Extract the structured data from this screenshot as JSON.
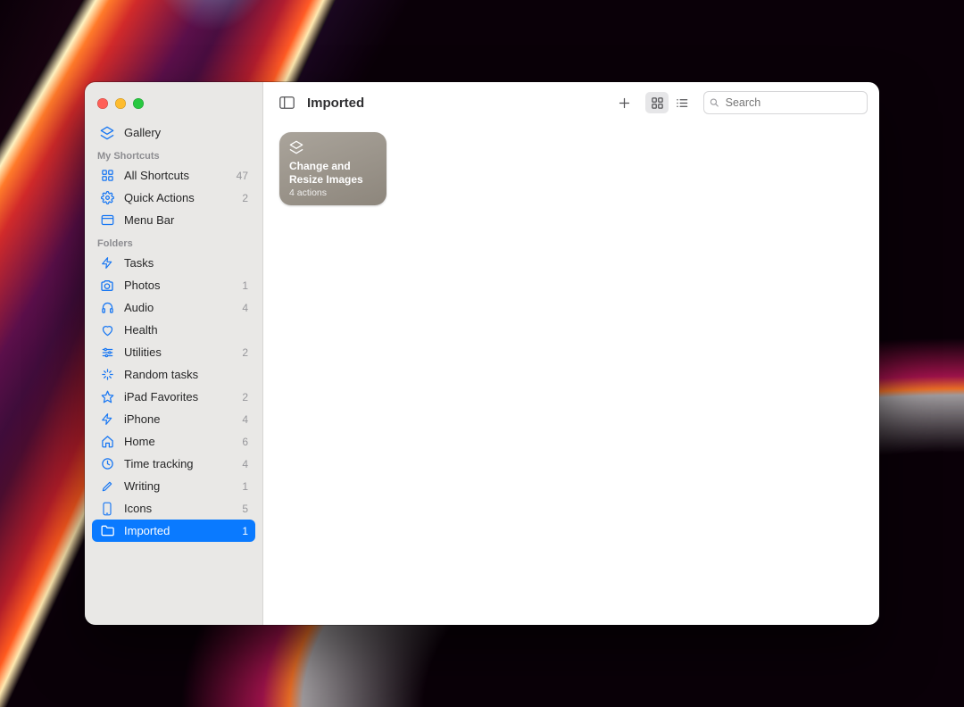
{
  "window": {
    "title": "Imported"
  },
  "toolbar": {
    "search_placeholder": "Search",
    "view_mode": "grid"
  },
  "sidebar": {
    "gallery_label": "Gallery",
    "sections": [
      {
        "header": "My Shortcuts",
        "items": [
          {
            "icon": "grid-icon",
            "label": "All Shortcuts",
            "count": "47"
          },
          {
            "icon": "gear-icon",
            "label": "Quick Actions",
            "count": "2"
          },
          {
            "icon": "menubar-icon",
            "label": "Menu Bar",
            "count": ""
          }
        ]
      },
      {
        "header": "Folders",
        "items": [
          {
            "icon": "bolt-icon",
            "label": "Tasks",
            "count": ""
          },
          {
            "icon": "camera-icon",
            "label": "Photos",
            "count": "1"
          },
          {
            "icon": "headphones-icon",
            "label": "Audio",
            "count": "4"
          },
          {
            "icon": "heart-icon",
            "label": "Health",
            "count": ""
          },
          {
            "icon": "sliders-icon",
            "label": "Utilities",
            "count": "2"
          },
          {
            "icon": "sparkle-icon",
            "label": "Random tasks",
            "count": ""
          },
          {
            "icon": "star-icon",
            "label": "iPad Favorites",
            "count": "2"
          },
          {
            "icon": "bolt-icon",
            "label": "iPhone",
            "count": "4"
          },
          {
            "icon": "home-icon",
            "label": "Home",
            "count": "6"
          },
          {
            "icon": "clock-icon",
            "label": "Time tracking",
            "count": "4"
          },
          {
            "icon": "pencil-icon",
            "label": "Writing",
            "count": "1"
          },
          {
            "icon": "phone-icon",
            "label": "Icons",
            "count": "5"
          },
          {
            "icon": "folder-icon",
            "label": "Imported",
            "count": "1",
            "selected": true
          }
        ]
      }
    ]
  },
  "shortcuts": [
    {
      "icon": "layers-icon",
      "title": "Change and Resize Images",
      "subtitle": "4 actions"
    }
  ]
}
